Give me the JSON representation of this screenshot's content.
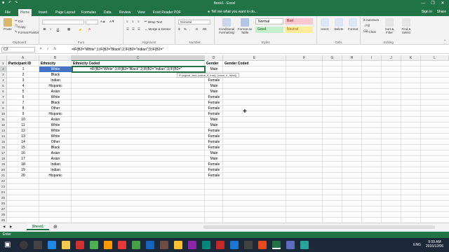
{
  "window": {
    "title": "Book1 - Excel",
    "controls": [
      "minimize",
      "restore",
      "close"
    ]
  },
  "tabs": [
    {
      "label": "File",
      "active": false
    },
    {
      "label": "Home",
      "active": true
    },
    {
      "label": "Insert",
      "active": false
    },
    {
      "label": "Page Layout",
      "active": false
    },
    {
      "label": "Formulas",
      "active": false
    },
    {
      "label": "Data",
      "active": false
    },
    {
      "label": "Review",
      "active": false
    },
    {
      "label": "View",
      "active": false
    },
    {
      "label": "Foxit Reader PDF",
      "active": false
    }
  ],
  "tell_me": "Tell me what you want to do...",
  "account": {
    "signin": "Sign in",
    "share": "Share"
  },
  "ribbon": {
    "clipboard": {
      "paste": "Paste",
      "cut": "Cut",
      "copy": "Copy",
      "format_painter": "Format Painter",
      "label": "Clipboard"
    },
    "font": {
      "label": "Font"
    },
    "alignment": {
      "wrap": "Wrap Text",
      "merge": "Merge & Center",
      "label": "Alignment"
    },
    "number": {
      "format": "General",
      "label": "Number"
    },
    "styles": {
      "conditional": "Conditional Formatting",
      "format_table": "Format as Table",
      "normal": "Normal",
      "bad": "Bad",
      "good": "Good",
      "neutral": "Neutral",
      "label": "Styles"
    },
    "cells": {
      "insert": "Insert",
      "delete": "Delete",
      "format": "Format",
      "label": "Cells"
    },
    "editing": {
      "autosum": "AutoSum",
      "fill": "Fill",
      "clear": "Clear",
      "sort": "Sort & Filter",
      "find": "Find & Select",
      "label": "Editing"
    }
  },
  "formula_bar": {
    "name_box": "C2",
    "formula": "=IF(B2=\"White\";1;IF(B2=\"Black\";2;IF(B2=\"Indian\";3;IF(B2=\""
  },
  "columns": [
    "A",
    "B",
    "C",
    "D",
    "E",
    "F",
    "G",
    "H",
    "I",
    "J",
    "K",
    "L"
  ],
  "rows": [
    "1",
    "2",
    "3",
    "4",
    "5",
    "6",
    "7",
    "8",
    "9",
    "10",
    "11",
    "12",
    "13",
    "14",
    "15",
    "16",
    "17",
    "18",
    "19",
    "20",
    "21",
    "22",
    "23",
    "24",
    "25",
    "26",
    "27",
    "28",
    "29"
  ],
  "headers": {
    "participant": "Participant ID",
    "ethnicity": "Ethnicity",
    "ethnicity_coded": "Ethnicity Coded",
    "gender": "Gender",
    "gender_coded": "Gender Coded"
  },
  "table": [
    {
      "id": "1",
      "ethnicity": "White",
      "gender": "Male"
    },
    {
      "id": "2",
      "ethnicity": "Black",
      "gender": "Male"
    },
    {
      "id": "3",
      "ethnicity": "Indian",
      "gender": "Female"
    },
    {
      "id": "4",
      "ethnicity": "Hispanic",
      "gender": "Male"
    },
    {
      "id": "5",
      "ethnicity": "Asian",
      "gender": "Male"
    },
    {
      "id": "6",
      "ethnicity": "White",
      "gender": "Female"
    },
    {
      "id": "7",
      "ethnicity": "Black",
      "gender": "Female"
    },
    {
      "id": "8",
      "ethnicity": "Other",
      "gender": "Female"
    },
    {
      "id": "9",
      "ethnicity": "Hispanic",
      "gender": "Female"
    },
    {
      "id": "10",
      "ethnicity": "Asian",
      "gender": "Male"
    },
    {
      "id": "11",
      "ethnicity": "White",
      "gender": "Male"
    },
    {
      "id": "12",
      "ethnicity": "White",
      "gender": "Female"
    },
    {
      "id": "13",
      "ethnicity": "White",
      "gender": "Female"
    },
    {
      "id": "14",
      "ethnicity": "Other",
      "gender": "Female"
    },
    {
      "id": "15",
      "ethnicity": "Black",
      "gender": "Female"
    },
    {
      "id": "16",
      "ethnicity": "Asian",
      "gender": "Male"
    },
    {
      "id": "17",
      "ethnicity": "Asian",
      "gender": "Male"
    },
    {
      "id": "18",
      "ethnicity": "Indian",
      "gender": "Female"
    },
    {
      "id": "19",
      "ethnicity": "Indian",
      "gender": "Female"
    },
    {
      "id": "20",
      "ethnicity": "Hispanic",
      "gender": "Female"
    }
  ],
  "editing_cell": {
    "text": "=IF(B2=\"White\";1;IF(B2=\"Black\";2;IF(B2=\"Indian\";3;IF(B2=\"",
    "tooltip_fn": "IF(logical_test; [value_if_true]; [value_if_false])"
  },
  "sheet_tab": "Sheet1",
  "status": "Enter",
  "clock": {
    "time": "9:59 AM",
    "date": "2016/12/06"
  },
  "lang": "ENG",
  "colors": {
    "excel_green": "#217346",
    "selection_blue": "#4472c4"
  }
}
